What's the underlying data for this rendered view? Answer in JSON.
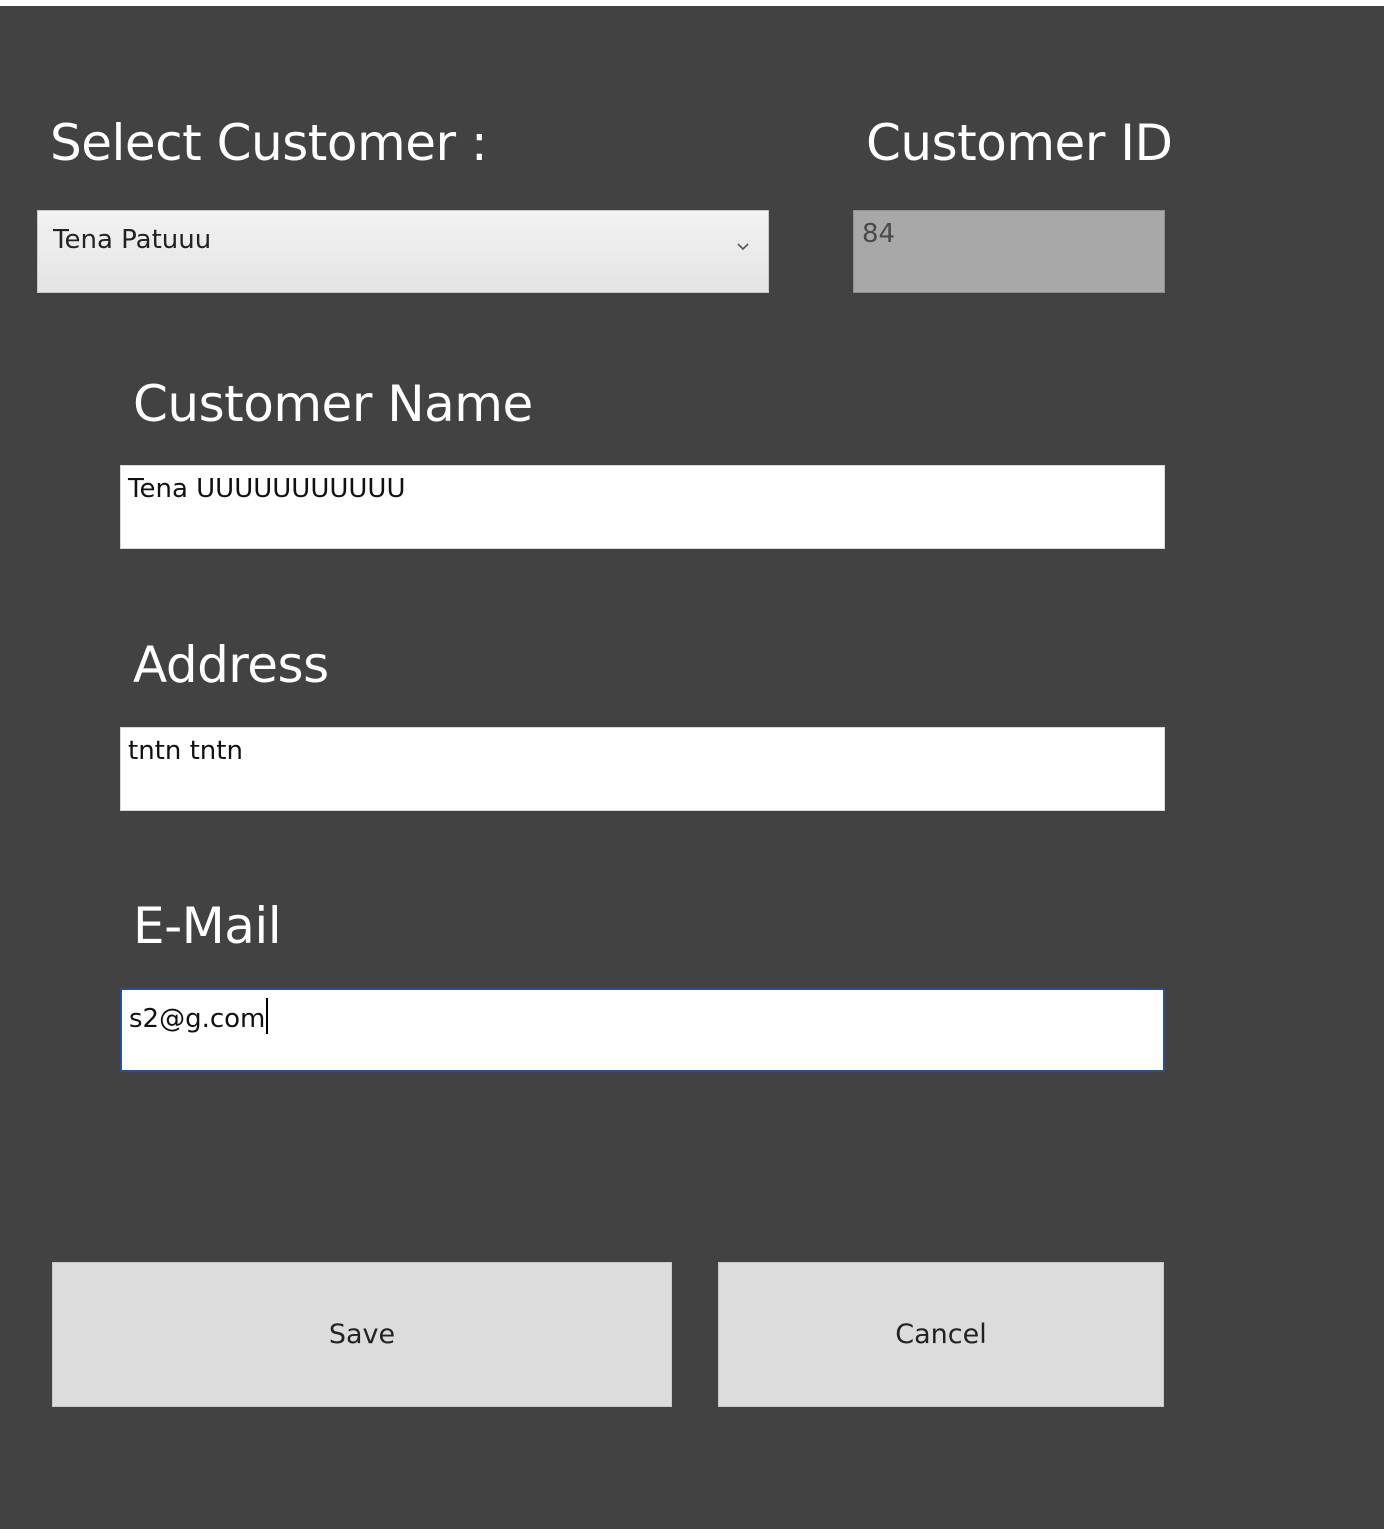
{
  "form": {
    "select_customer_label": "Select Customer :",
    "customer_id_label": "Customer ID",
    "customer_name_label": "Customer Name",
    "address_label": "Address",
    "email_label": "E-Mail"
  },
  "fields": {
    "selected_customer": "Tena Patuuu",
    "customer_id": "84",
    "customer_name": "Tena UUUUUUUUUUU",
    "address": "tntn tntn",
    "email": "s2@g.com"
  },
  "buttons": {
    "save_label": "Save",
    "cancel_label": "Cancel"
  },
  "icons": {
    "dropdown": "chevron-down-icon"
  },
  "colors": {
    "background": "#424242",
    "readonly_field": "#a8a8a8",
    "button": "#dcdcdc",
    "focus_border": "#2b4f8f"
  }
}
